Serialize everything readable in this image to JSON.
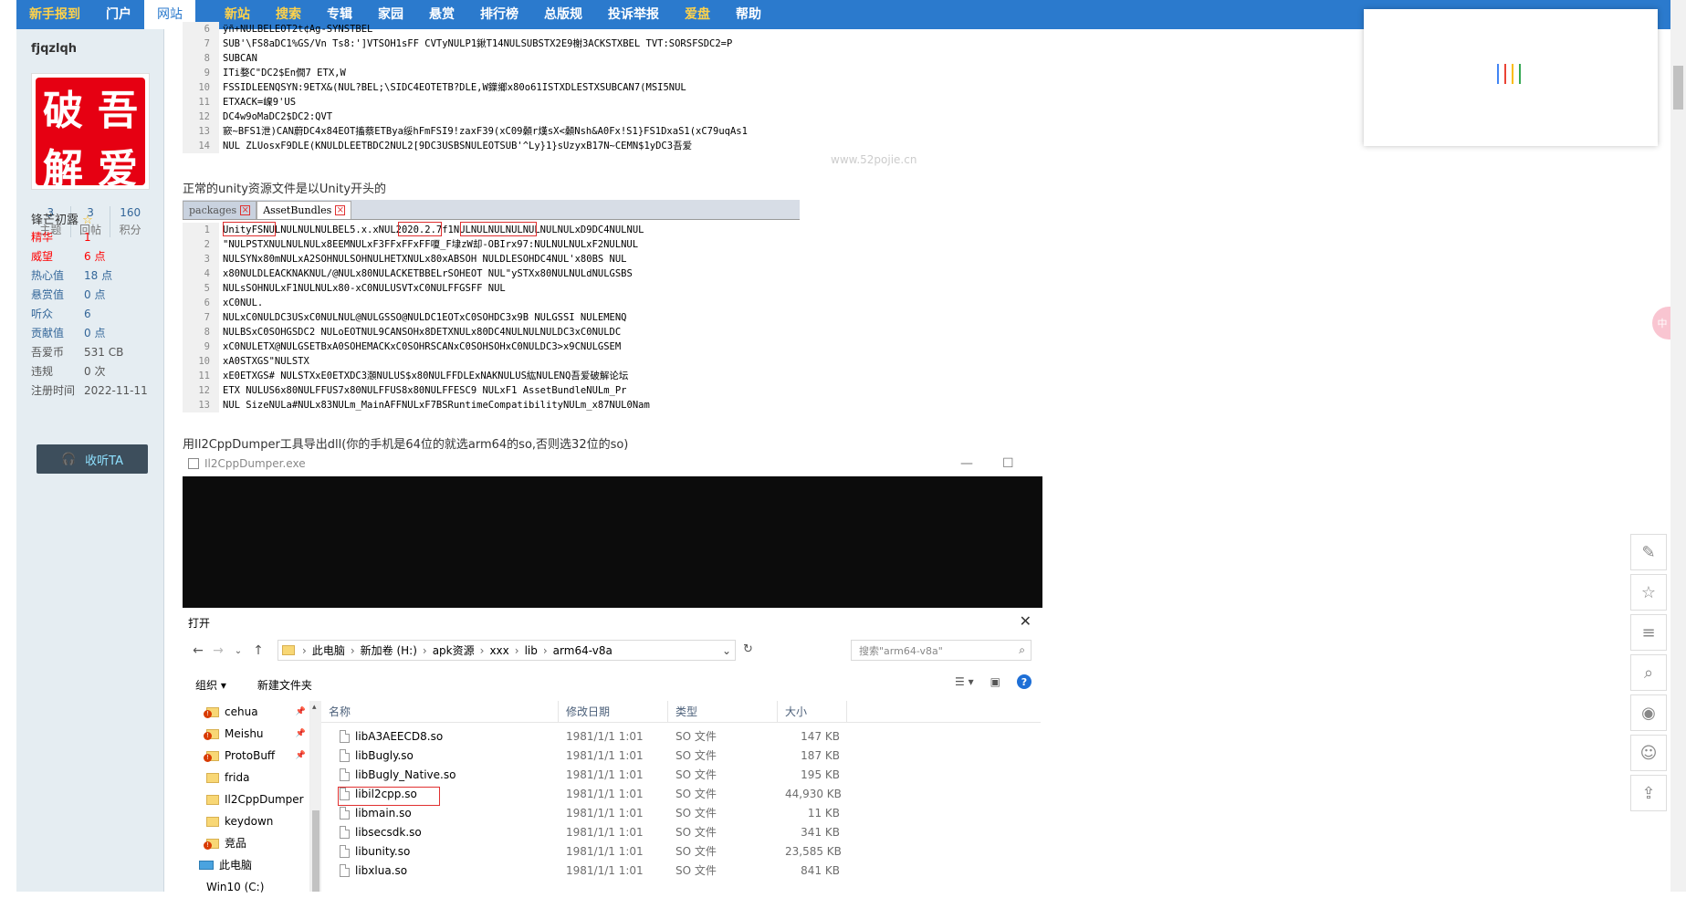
{
  "nav": {
    "items": [
      "新手报到",
      "门户",
      "网站",
      "新站",
      "搜索",
      "专辑",
      "家园",
      "悬赏",
      "排行榜",
      "总版规",
      "投诉举报",
      "爱盘",
      "帮助"
    ]
  },
  "user": {
    "name": "fjqzlqh",
    "avatar_chars": [
      "破",
      "吾",
      "解",
      "爱"
    ],
    "stats": [
      {
        "num": "3",
        "label": "主题"
      },
      {
        "num": "3",
        "label": "回帖"
      },
      {
        "num": "160",
        "label": "积分"
      }
    ],
    "rank": "锋芒初露",
    "props": [
      {
        "k": "精华",
        "v": "1"
      },
      {
        "k": "威望",
        "v": "6 点"
      },
      {
        "k": "热心值",
        "v": "18 点"
      },
      {
        "k": "悬赏值",
        "v": "0 点"
      },
      {
        "k": "听众",
        "v": "6"
      },
      {
        "k": "贡献值",
        "v": "0 点"
      },
      {
        "k": "吾爱币",
        "v": "531 CB"
      },
      {
        "k": "违规",
        "v": "0 次"
      },
      {
        "k": "注册时间",
        "v": "2022-11-11"
      }
    ],
    "follow_label": "收听TA"
  },
  "post": {
    "caption1": "正常的unity资源文件是以Unity开头的",
    "caption2": "用Il2CppDumper工具导出dll(你的手机是64位的就选arm64的so,否则选32位的so)",
    "watermark": "吾爱破解论坛",
    "watermark_url": "www.52pojie.cn"
  },
  "hex1": {
    "lines": [
      {
        "n": "6",
        "t": "ÿñ+NULBELEOT2t¢Ag-SYNSTBEL"
      },
      {
        "n": "7",
        "t": "SUB'\\FS8aDC1%GS/Vn Ts8:']VTSOH1sFF  CVTyNULP1鍬T14NULSUBSTX2E9榭3ACKSTXBEL TVT:SORSFSDC2=P"
      },
      {
        "n": "8",
        "t": "SUBCAN"
      },
      {
        "n": "9",
        "t": "ITi婺C\"DC2$En僩7    ETX,W"
      },
      {
        "n": "10",
        "t": "FSSIDLEENQSYN:9ETX&(NUL?BEL;\\SIDC4EOTETB?DLE,W鐷鄉x80o61ISTXDLESTXSUBCAN7(MSI5NUL"
      },
      {
        "n": "11",
        "t": "ETXACK=嵲9'US"
      },
      {
        "n": "12",
        "t": "DC4w9oMaDC2$DC2:QVT"
      },
      {
        "n": "13",
        "t": "窾~BFS1泄)CAN蔚DC4x84EOT搐蔡ETBya绥hFmFSI9!zaxF39(xC09顙r熯sX<顙Nsh&A0Fx!S1}FS1DxaS1(xC79uqAs1"
      },
      {
        "n": "14",
        "t": "NUL ZLUosxF9DLE(KNULDLEETBDC2NUL2[9DC3USBSNULEOTSUB'^Ly}1}sUzyxB17N~CEMN$1yDC3吾爱"
      }
    ]
  },
  "editor": {
    "tabs": [
      "packages",
      "AssetBundles"
    ],
    "lines": [
      {
        "n": "1",
        "t": "UnityFSNULNULNULNULBEL5.x.xNUL2020.2.7f1NULNULNULNULNULNULNULxD9DC4NULNUL"
      },
      {
        "n": "2",
        "t": "\"NULPSTXNULNULNULx8EEMNULxF3FFxFFxFF嗄_F埭zW却-OBIrx97:NULNULNULxF2NULNUL"
      },
      {
        "n": "3",
        "t": "NULSYNx80mNULxA2SOHNULSOHNULHETXNULx80xABSOH NULDLESOHDC4NUL'x80BS NUL"
      },
      {
        "n": "4",
        "t": "x80NULDLEACKNAKNUL/@NULx80NULACKETBBELrSOHEOT NUL\"ySTXx80NULNULdNULGSBS"
      },
      {
        "n": "5",
        "t": " NULsSOHNULxF1NULNULx80-xC0NULUSVTxC0NULFFGSFF NUL"
      },
      {
        "n": "6",
        "t": "xC0NUL."
      },
      {
        "n": "7",
        "t": "NULxC0NULDC3USxC0NULNUL@NULGSSO@NULDC1EOTxC0SOHDC3x9B NULGSSI NULEMENQ"
      },
      {
        "n": "8",
        "t": " NULBSxC0SOHGSDC2 NULoEOTNUL9CANSOHx8DETXNULx80DC4NULNULNULDC3xC0NULDC"
      },
      {
        "n": "9",
        "t": "xC0NULETX@NULGSETBxA0SOHEMACKxC0SOHRSCANxC0SOHSOHxC0NULDC3>x9CNULGSEM"
      },
      {
        "n": "10",
        "t": "xA0STXGS\"NULSTX"
      },
      {
        "n": "11",
        "t": "xE0ETXGS# NULSTXxE0ETXDC3㶊NULUS$x80NULFFDLExNAKNULUS紘NULENQ吾爱破解论坛"
      },
      {
        "n": "12",
        "t": "ETX NULUS6x80NULFFUS7x80NULFFUS8x80NULFFESC9 NULxF1  AssetBundleNULm_Pr"
      },
      {
        "n": "13",
        "t": "NUL SizeNULa#NULx83NULm_MainAFFNULxF7BSRuntimeCompatibilityNULm_x87NUL0Nam"
      }
    ]
  },
  "il2cpp": {
    "title": "Il2CppDumper.exe",
    "min": "—",
    "max": "☐"
  },
  "dialog": {
    "title": "打开",
    "close": "✕",
    "path": [
      "此电脑",
      "新加卷 (H:)",
      "apk资源",
      "xxx",
      "lib",
      "arm64-v8a"
    ],
    "search_placeholder": "搜索\"arm64-v8a\"",
    "organize": "组织 ▾",
    "new_folder": "新建文件夹",
    "tree": [
      {
        "label": "cehua",
        "pin": true,
        "warn": true
      },
      {
        "label": "Meishu",
        "pin": true,
        "warn": true
      },
      {
        "label": "ProtoBuff",
        "pin": true,
        "warn": true
      },
      {
        "label": "frida",
        "pin": false,
        "warn": false
      },
      {
        "label": "Il2CppDumper",
        "pin": false,
        "warn": false
      },
      {
        "label": "keydown",
        "pin": false,
        "warn": false
      },
      {
        "label": "竞品",
        "pin": false,
        "warn": true
      }
    ],
    "tree_pc": "此电脑",
    "tree_drive": "Win10 (C:)",
    "columns": [
      "名称",
      "修改日期",
      "类型",
      "大小"
    ],
    "files": [
      {
        "name": "libA3AEECD8.so",
        "date": "1981/1/1 1:01",
        "type": "SO 文件",
        "size": "147 KB"
      },
      {
        "name": "libBugly.so",
        "date": "1981/1/1 1:01",
        "type": "SO 文件",
        "size": "187 KB"
      },
      {
        "name": "libBugly_Native.so",
        "date": "1981/1/1 1:01",
        "type": "SO 文件",
        "size": "195 KB"
      },
      {
        "name": "libil2cpp.so",
        "date": "1981/1/1 1:01",
        "type": "SO 文件",
        "size": "44,930 KB"
      },
      {
        "name": "libmain.so",
        "date": "1981/1/1 1:01",
        "type": "SO 文件",
        "size": "11 KB"
      },
      {
        "name": "libsecsdk.so",
        "date": "1981/1/1 1:01",
        "type": "SO 文件",
        "size": "341 KB"
      },
      {
        "name": "libunity.so",
        "date": "1981/1/1 1:01",
        "type": "SO 文件",
        "size": "23,585 KB"
      },
      {
        "name": "libxlua.so",
        "date": "1981/1/1 1:01",
        "type": "SO 文件",
        "size": "841 KB"
      }
    ]
  },
  "right_tools": [
    "edit-icon",
    "star-icon",
    "list-icon",
    "search-icon",
    "wechat-icon",
    "user-icon",
    "top-icon"
  ],
  "side_bubble": "中",
  "colors": {
    "nav": "#2b7acd",
    "highlight": "#e03030"
  }
}
